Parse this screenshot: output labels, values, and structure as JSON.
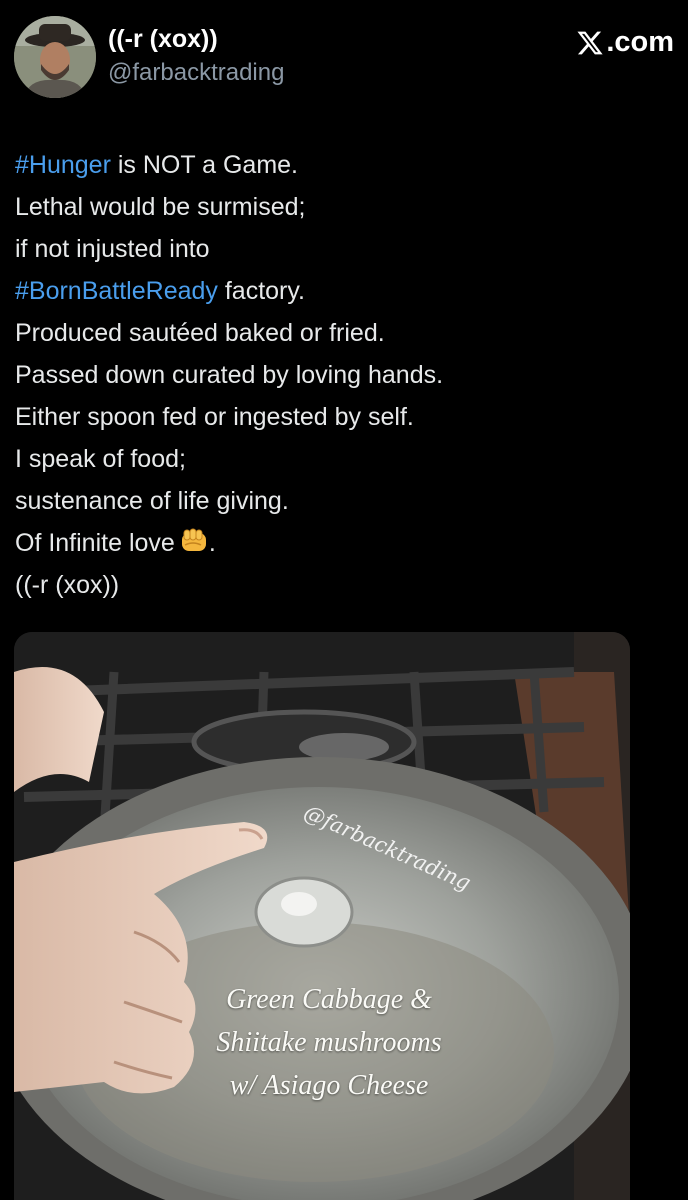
{
  "post": {
    "author": {
      "display_name": "((-r (xox))",
      "handle": "@farbacktrading"
    },
    "brand": {
      "logo_icon": "x-logo-icon",
      "label": ".com"
    },
    "text": {
      "l1_hashtag": "#Hunger",
      "l1_rest": " is NOT a Game.",
      "l2": "Lethal would be surmised;",
      "l3": "if not injusted into",
      "l4_hashtag": "#BornBattleReady",
      "l4_rest": " factory.",
      "l5": "Produced sautéed baked or fried.",
      "l6": "Passed down curated by loving hands.",
      "l7": "Either spoon fed or ingested by self.",
      "l8": "I speak of food;",
      "l9": "sustenance of life giving.",
      "l10_start": "Of Infinite love",
      "l10_icon": "oncoming-fist-icon",
      "l10_end": ".",
      "l11": "((-r (xox))"
    },
    "media": {
      "watermark": "@farbacktrading",
      "caption_line1": "Green Cabbage &",
      "caption_line2": "Shiitake mushrooms",
      "caption_line3": "w/ Asiago Cheese"
    },
    "colors": {
      "background": "#000000",
      "text": "#e7e9ea",
      "hashtag": "#4a9eed",
      "handle": "#8b98a5"
    }
  }
}
